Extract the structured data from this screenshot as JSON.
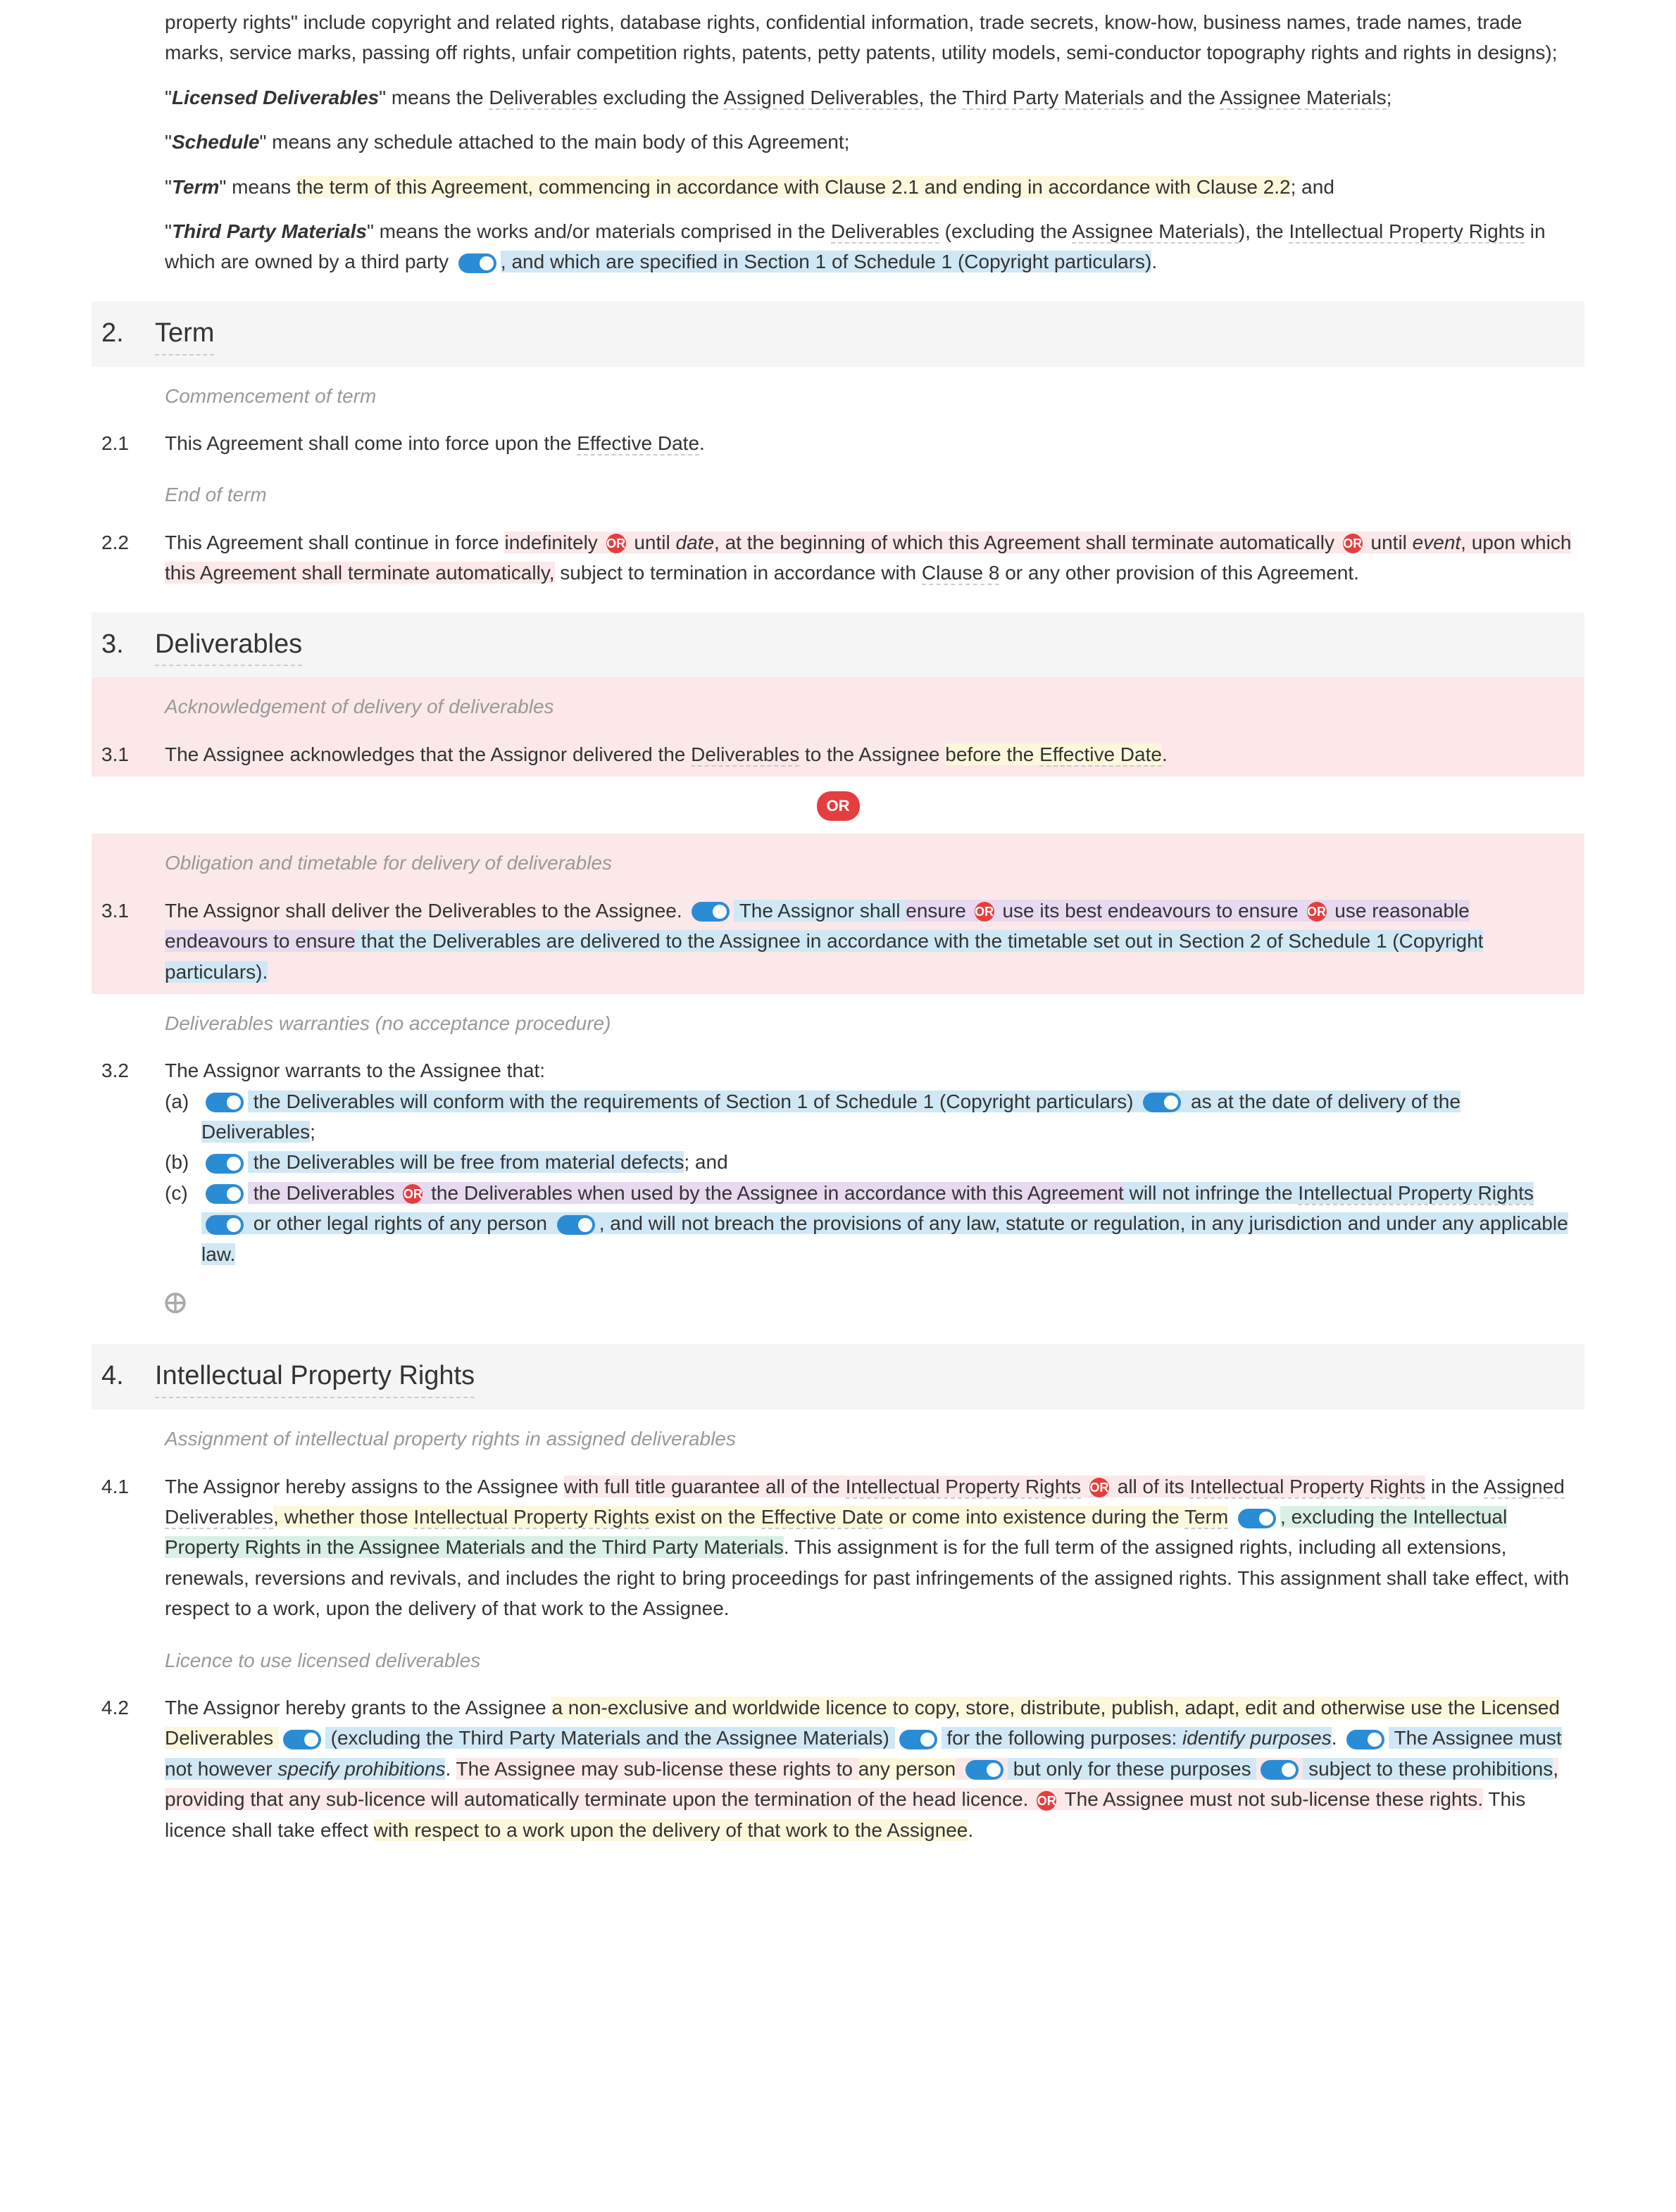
{
  "d1": {
    "p1": "property rights\" include copyright and related rights, database rights, confidential information, trade secrets, know-how, business names, trade names, trade marks, service marks, passing off rights, unfair competition rights, patents, petty patents, utility models, semi-conductor topography rights and rights in designs);"
  },
  "d2": {
    "term": "Licensed Deliverables",
    "t1": "\" means the ",
    "deliv": "Deliverables",
    "t2": " excluding the ",
    "ad": "Assigned Deliverables",
    "t3": ", the ",
    "tpm": "Third Party Materials",
    "t4": " and the ",
    "am": "Assignee Materials",
    "t5": ";"
  },
  "d3": {
    "term": "Schedule",
    "text": "\" means any schedule attached to the main body of this Agreement;"
  },
  "d4": {
    "term": "Term",
    "t1": "\" means ",
    "y1": "the term of this Agreement, commencing in accordance with Clause 2.1 and ending in accordance with Clause 2.2",
    "t2": "; and"
  },
  "d5": {
    "term": "Third Party Materials",
    "t1": "\" means the works and/or materials comprised in the ",
    "deliv": "Deliverables",
    "t2": " (excluding the ",
    "am": "Assignee Materials",
    "t3": "), the ",
    "ipr": "Intellectual Property Rights",
    "t4": " in which are owned by a third party ",
    "b1": ", and which are specified in Section 1 of Schedule 1 (Copyright particulars)",
    "t5": "."
  },
  "s2": {
    "num": "2.",
    "title": "Term"
  },
  "s2sub1": "Commencement of term",
  "c21": {
    "num": "2.1",
    "t1": "This Agreement shall come into force upon the ",
    "ed": "Effective Date",
    "t2": "."
  },
  "s2sub2": "End of term",
  "c22": {
    "num": "2.2",
    "t1": "This Agreement shall continue in force ",
    "p1": "indefinitely ",
    "or": "OR",
    "p2": " until ",
    "date": "date",
    "p3": ", at the beginning of which this Agreement shall terminate automatically ",
    "p4": " until ",
    "event": "event",
    "p5": ", upon which this Agreement shall terminate automatically,",
    "t2": " subject to termination in accordance with ",
    "c8": "Clause 8",
    "t3": " or any other provision of this Agreement."
  },
  "s3": {
    "num": "3.",
    "title": "Deliverables"
  },
  "s3sub1": "Acknowledgement of delivery of deliverables",
  "c31a": {
    "num": "3.1",
    "t1": "The Assignee acknowledges that the Assignor delivered the ",
    "deliv": "Deliverables",
    "t2": " to the Assignee ",
    "p1": "before the ",
    "ed": "Effective Date",
    "t3": "."
  },
  "orBig": "OR",
  "s3sub2": "Obligation and timetable for delivery of deliverables",
  "c31b": {
    "num": "3.1",
    "t1": "The Assignor shall deliver the Deliverables to the Assignee. ",
    "b1": " The Assignor shall ",
    "pu1": "ensure ",
    "or": "OR",
    "pu2": " use its best endeavours to ensure ",
    "pu3": " use reasonable endeavours to ensure",
    "b2": " that the Deliverables are delivered to the Assignee in accordance with the timetable set out in Section 2 of Schedule 1 (Copyright particulars)."
  },
  "s3sub3": "Deliverables warranties (no acceptance procedure)",
  "c32": {
    "num": "3.2",
    "intro": "The Assignor warrants to the Assignee that:",
    "a": {
      "l": "(a)",
      "t1": " the Deliverables will conform with the requirements of Section 1 of Schedule 1 (Copyright particulars) ",
      "t2": " as at the date of delivery of the Deliverables",
      "t3": ";"
    },
    "b": {
      "l": "(b)",
      "t1": " the Deliverables will be free from material defects",
      "t2": "; and"
    },
    "c": {
      "l": "(c)",
      "t1": " the Deliverables ",
      "or": "OR",
      "t2": " the Deliverables when used by the Assignee in accordance with this Agreement",
      "t3": " will not infringe the ",
      "ipr": "Intellectual Property Rights",
      "t4": " ",
      "t5": " or other legal rights",
      "t6": " of any person ",
      "t7": ", and will not breach the provisions of any law, statute or regulation,",
      "t8": " in any jurisdiction and under any applicable law."
    }
  },
  "s4": {
    "num": "4.",
    "title": "Intellectual Property Rights"
  },
  "s4sub1": "Assignment of intellectual property rights in assigned deliverables",
  "c41": {
    "num": "4.1",
    "t1": "The Assignor hereby assigns to the Assignee ",
    "p1": "with full title guarantee all of the ",
    "ipr1": "Intellectual Property Rights",
    "or": "OR",
    "p2": " all of its ",
    "ipr2": "Intellectual Property Rights",
    "t2": " in the ",
    "ad": "Assigned Deliverables",
    "y1": ", whether those ",
    "ipr3": "Intellectual Property Rights",
    "y2": " exist on the ",
    "ed": "Effective Date",
    "y3": " or come into existence during the ",
    "trm": "Term",
    "g1": ", excluding the Intellectual Property Rights in the Assignee Materials and the Third Party Materials",
    "t3": ". This assignment is for the full term of the assigned rights, including all extensions, renewals, reversions and revivals, and includes the right to bring proceedings for past infringements of the assigned rights. This assignment shall take effect, with respect to a work, upon the delivery of that work to the Assignee."
  },
  "s4sub2": "Licence to use licensed deliverables",
  "c42": {
    "num": "4.2",
    "t1": "The Assignor hereby grants to the Assignee ",
    "y1": "a non-exclusive and worldwide licence to copy, store, distribute, publish, adapt, edit and otherwise use the Licensed Deliverables ",
    "b1": " (excluding the Third Party Materials and the Assignee Materials) ",
    "b2": " for the following purposes: ",
    "ip": "identify purposes",
    "t2": ". ",
    "b3": " The Assignee must not however ",
    "sp": "specify prohibitions",
    "t3": ". ",
    "p1": "The Assignee may sub-license these rights to ",
    "anyp": "any person",
    "b4": " but only for these purposes ",
    "b5": " subject to these prohibitions",
    "p2": ", providing that any sub-licence will automatically terminate upon the termination of the head licence. ",
    "or": "OR",
    "p3": " The Assignee must not sub-license these rights.",
    "t4": " This licence shall take effect ",
    "y2": "with respect to a work upon the delivery of that work to the Assignee",
    "t5": "."
  }
}
